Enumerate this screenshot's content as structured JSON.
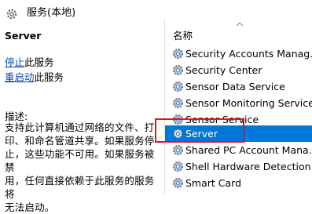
{
  "titlebar": {
    "title": "服务(本地)",
    "icon": "services-gear-icon"
  },
  "left_panel": {
    "service_name": "Server",
    "actions": [
      {
        "link": "停止",
        "suffix": "此服务"
      },
      {
        "link": "重启动",
        "suffix": "此服务"
      }
    ],
    "description_label": "描述:",
    "description_lines": [
      "支持此计算机通过网络的文件、打",
      "印、和命名管道共享。如果服务停",
      "止，这些功能不可用。如果服务被禁",
      "用，任何直接依赖于此服务的服务将",
      "无法启动。"
    ]
  },
  "list": {
    "column_header": "名称",
    "selected_index": 5,
    "services": [
      "Security Accounts Manag...",
      "Security Center",
      "Sensor Data Service",
      "Sensor Monitoring Service",
      "Sensor Service",
      "Server",
      "Shared PC Account Mana...",
      "Shell Hardware Detection",
      "Smart Card"
    ]
  },
  "colors": {
    "selection": "#0078d7",
    "highlight_box": "#e81123",
    "link": "#0645ad"
  }
}
